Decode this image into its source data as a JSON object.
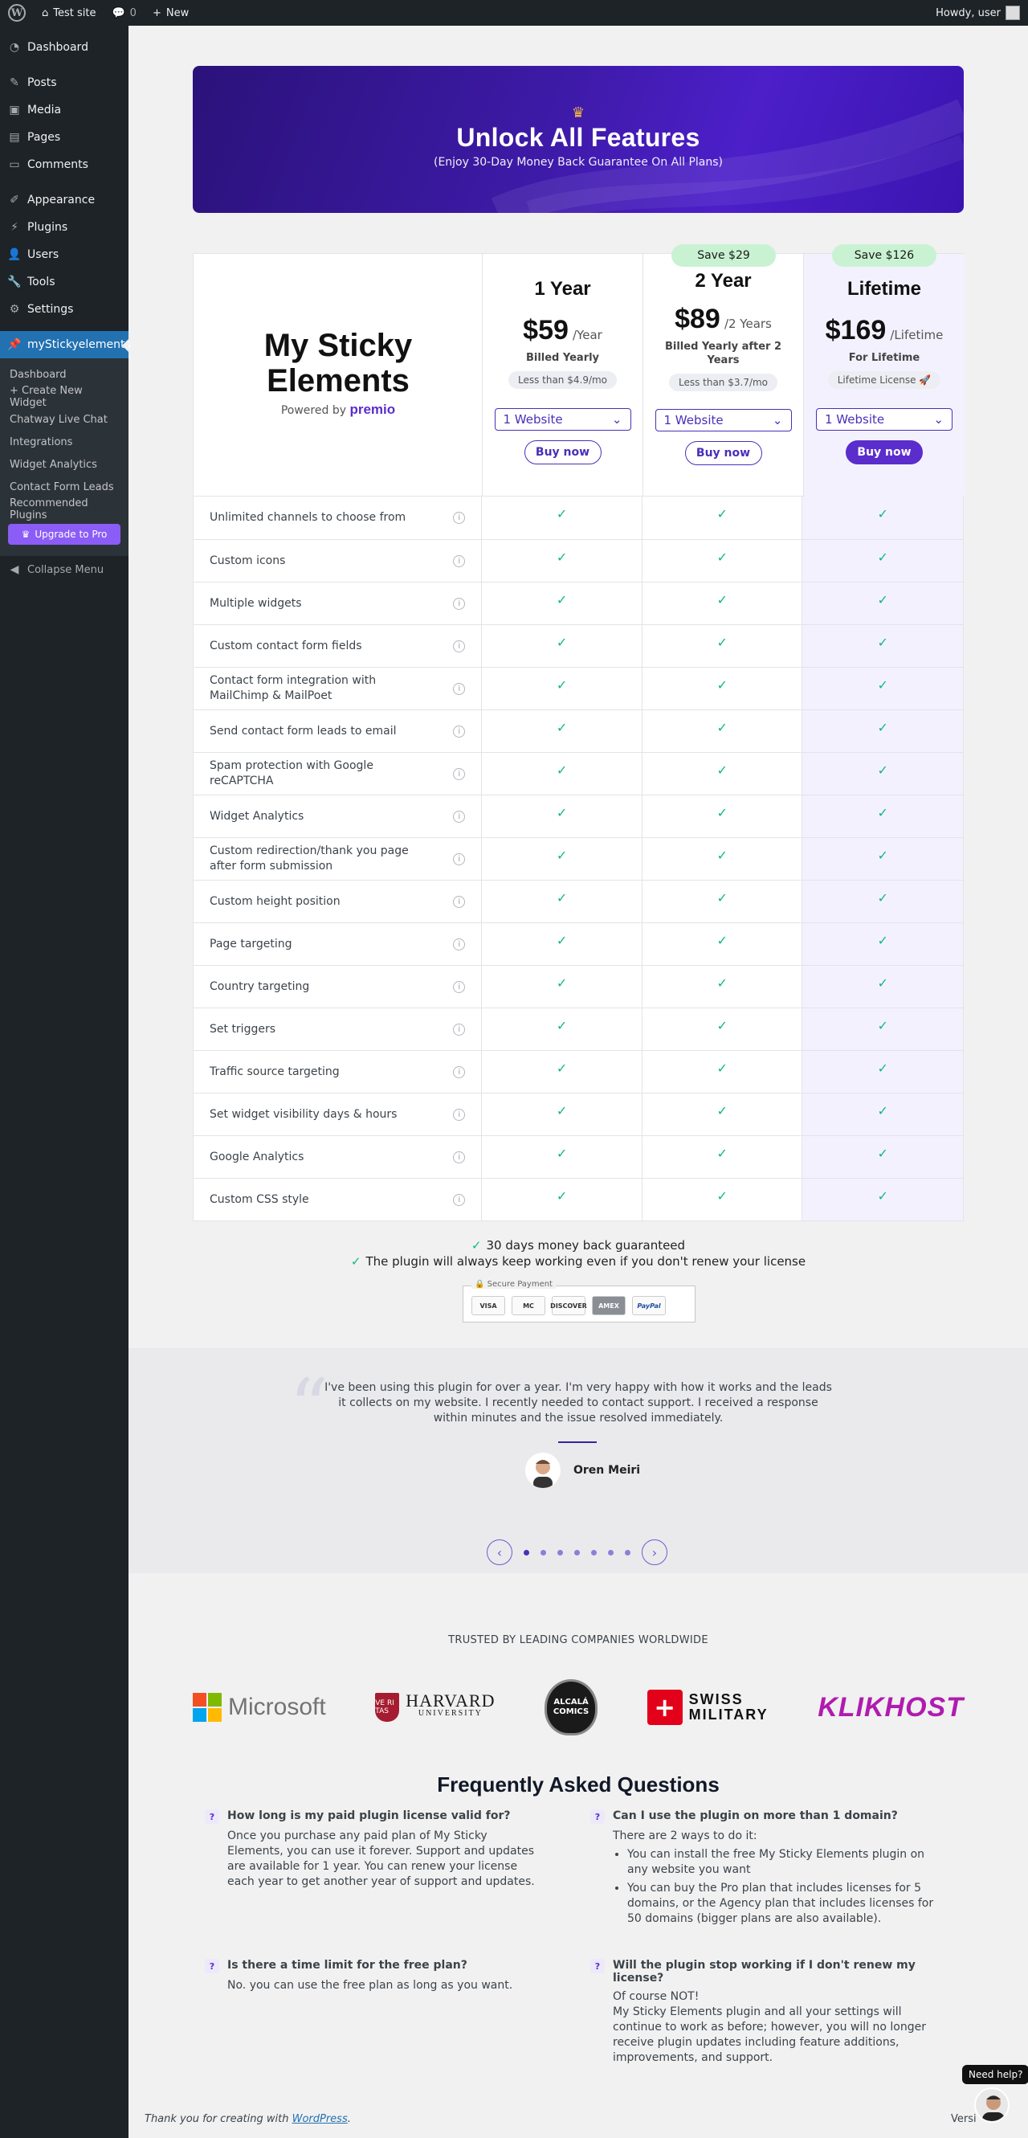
{
  "adminbar": {
    "site_name": "Test site",
    "comments_count": "0",
    "new_label": "New",
    "howdy": "Howdy, user"
  },
  "sidebar": {
    "items": [
      {
        "label": "Dashboard",
        "icon": "dashboard-icon"
      },
      {
        "label": "Posts",
        "icon": "pin-icon"
      },
      {
        "label": "Media",
        "icon": "media-icon"
      },
      {
        "label": "Pages",
        "icon": "pages-icon"
      },
      {
        "label": "Comments",
        "icon": "comment-icon"
      },
      {
        "label": "Appearance",
        "icon": "brush-icon"
      },
      {
        "label": "Plugins",
        "icon": "plugin-icon"
      },
      {
        "label": "Users",
        "icon": "users-icon"
      },
      {
        "label": "Tools",
        "icon": "wrench-icon"
      },
      {
        "label": "Settings",
        "icon": "settings-icon"
      },
      {
        "label": "myStickyelements",
        "icon": "pin-icon"
      }
    ],
    "submenu": [
      "Dashboard",
      "+ Create New Widget",
      "Chatway Live Chat",
      "Integrations",
      "Widget Analytics",
      "Contact Form Leads",
      "Recommended Plugins"
    ],
    "upgrade_label": "Upgrade to Pro",
    "collapse_label": "Collapse Menu"
  },
  "hero": {
    "title": "Unlock All Features",
    "subtitle": "(Enjoy 30-Day Money Back Guarantee On All Plans)"
  },
  "brand": {
    "name_line1": "My Sticky",
    "name_line2": "Elements",
    "powered_by": "Powered by",
    "premio": "premio"
  },
  "plans": [
    {
      "name": "1 Year",
      "price": "$59",
      "period": "/Year",
      "billed": "Billed Yearly",
      "pill": "Less than $4.9/mo",
      "select": "1 Website",
      "buy": "Buy now",
      "save": ""
    },
    {
      "name": "2 Year",
      "price": "$89",
      "period": "/2 Years",
      "billed": "Billed Yearly after 2 Years",
      "pill": "Less than $3.7/mo",
      "select": "1 Website",
      "buy": "Buy now",
      "save": "Save $29"
    },
    {
      "name": "Lifetime",
      "price": "$169",
      "period": "/Lifetime",
      "billed": "For Lifetime",
      "pill": "Lifetime License 🚀",
      "select": "1 Website",
      "buy": "Buy now",
      "save": "Save $126"
    }
  ],
  "features": [
    "Unlimited channels to choose from",
    "Custom icons",
    "Multiple widgets",
    "Custom contact form fields",
    "Contact form integration with MailChimp & MailPoet",
    "Send contact form leads to email",
    "Spam protection with Google reCAPTCHA",
    "Widget Analytics",
    "Custom redirection/thank you page after form submission",
    "Custom height position",
    "Page targeting",
    "Country targeting",
    "Set triggers",
    "Traffic source targeting",
    "Set widget visibility days & hours",
    "Google Analytics",
    "Custom CSS style"
  ],
  "guarantee": {
    "line1": "30 days money back guaranteed",
    "line2": "The plugin will always keep working even if you don't renew your license",
    "secure_label": "Secure Payment",
    "cards": [
      "VISA",
      "MC",
      "DISCOVER",
      "AMEX",
      "PayPal"
    ]
  },
  "testimonial": {
    "text": "I've been using this plugin for over a year. I'm very happy with how it works and the leads it collects on my website. I recently needed to contact support. I received a response within minutes and the issue resolved immediately.",
    "author": "Oren Meiri",
    "dots": 7,
    "active_dot": 1
  },
  "trusted": {
    "title": "TRUSTED BY LEADING COMPANIES WORLDWIDE",
    "logos": {
      "microsoft": "Microsoft",
      "harvard_big": "HARVARD",
      "harvard_small": "UNIVERSITY",
      "alcala1": "ALCALÁ",
      "alcala2": "COMICS",
      "swiss1": "SWISS",
      "swiss2": "MILITARY",
      "klikhost": "KLIKHOST"
    }
  },
  "faq": {
    "title": "Frequently Asked Questions",
    "q1": {
      "q": "How long is my paid plugin license valid for?",
      "a": "Once you purchase any paid plan of My Sticky Elements, you can use it forever. Support and updates are available for 1 year. You can renew your license each year to get another year of support and updates."
    },
    "q2": {
      "q": "Can I use the plugin on more than 1 domain?",
      "a": "There are 2 ways to do it:",
      "bullets": [
        "You can install the free My Sticky Elements plugin on any website you want",
        "You can buy the Pro plan that includes licenses for 5 domains, or the Agency plan that includes licenses for 50 domains (bigger plans are also available)."
      ]
    },
    "q3": {
      "q": "Is there a time limit for the free plan?",
      "a": "No. you can use the free plan as long as you want."
    },
    "q4": {
      "q": "Will the plugin stop working if I don't renew my license?",
      "a": "Of course NOT!",
      "a2": "My Sticky Elements plugin and all your settings will continue to work as before; however, you will no longer receive plugin updates including feature additions, improvements, and support."
    }
  },
  "footer": {
    "thanks_prefix": "Thank you for creating with",
    "wordpress": "WordPress",
    "thanks_suffix": ".",
    "version": "Versi"
  },
  "needhelp": "Need help?",
  "colors": {
    "accent": "#5b2dcc",
    "check": "#10b981",
    "admin_dark": "#1d2327",
    "active_menu": "#2271b1"
  }
}
